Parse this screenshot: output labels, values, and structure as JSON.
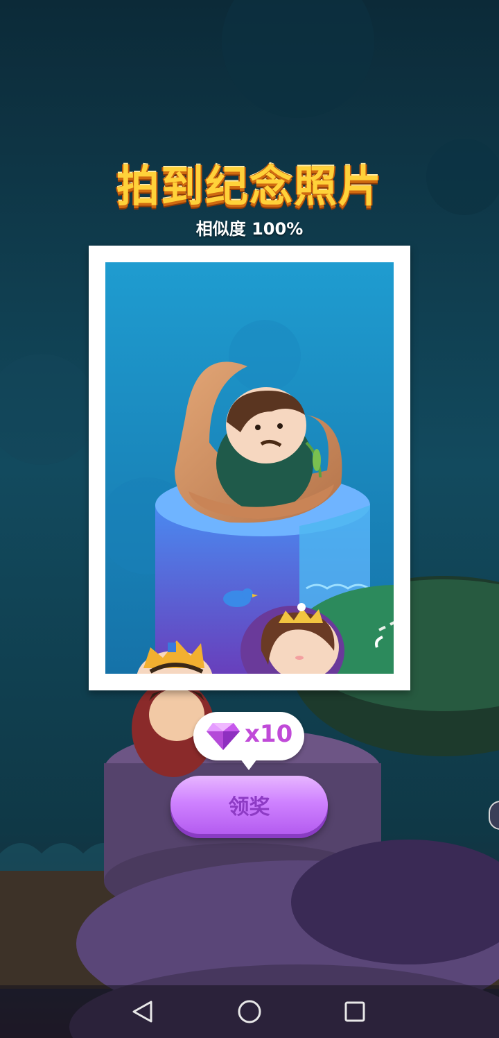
{
  "title": "拍到纪念照片",
  "similarity_label": "相似度 100%",
  "reward": {
    "icon": "diamond-gem-icon",
    "count_text": "x10"
  },
  "claim_button_label": "领奖",
  "nav": {
    "back_icon": "back-triangle-icon",
    "home_icon": "home-circle-icon",
    "recents_icon": "recents-square-icon"
  },
  "colors": {
    "title_yellow": "#ffd23a",
    "button_purple": "#cf82ff",
    "reward_text": "#c04ad8"
  }
}
